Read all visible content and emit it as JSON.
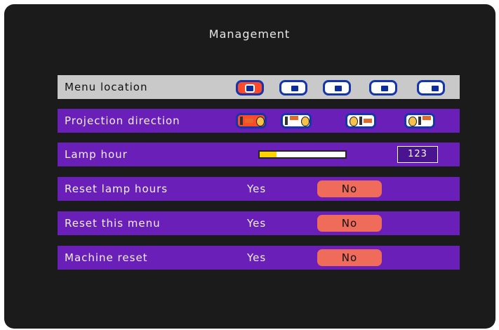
{
  "title": "Management",
  "rows": {
    "menu_location": {
      "label": "Menu location",
      "selected_index": 0,
      "options": 5
    },
    "projection_direction": {
      "label": "Projection direction",
      "selected_index": 0
    },
    "lamp_hour": {
      "label": "Lamp hour",
      "value": "123",
      "level": 0.2
    },
    "reset_lamp_hours": {
      "label": "Reset lamp hours",
      "yes": "Yes",
      "no": "No",
      "selected": "No"
    },
    "reset_this_menu": {
      "label": "Reset this menu",
      "yes": "Yes",
      "no": "No",
      "selected": "No"
    },
    "machine_reset": {
      "label": "Machine reset",
      "yes": "Yes",
      "no": "No",
      "selected": "No"
    }
  },
  "colors": {
    "panel": "#1b1b1b",
    "row": "#6a1fb8",
    "selected_row": "#c9c9c9",
    "active_option": "#ef6b5a",
    "lamp_fill": "#ffd400"
  }
}
